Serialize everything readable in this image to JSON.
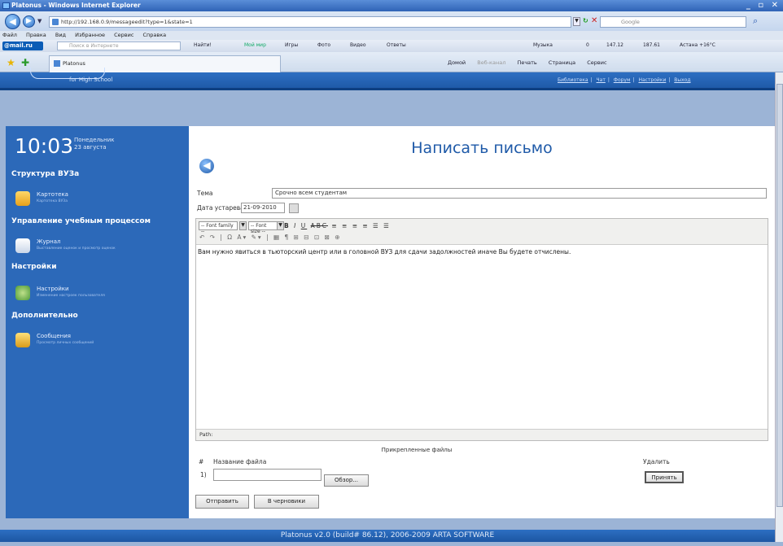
{
  "window": {
    "title": "Platonus - Windows Internet Explorer",
    "controls": "_ ▫ ✕"
  },
  "address": {
    "url": "http://192.168.0.9/messageedit?type=1&state=1",
    "search_placeholder": "Google"
  },
  "menu": [
    "Файл",
    "Правка",
    "Вид",
    "Избранное",
    "Сервис",
    "Справка"
  ],
  "toolbar2": {
    "logo": "@mail.ru",
    "search_placeholder": "Поиск в Интернете",
    "find": "Найти!",
    "items": [
      "Мой мир",
      "Игры",
      "Фото",
      "Видео",
      "Ответы",
      "Музыка",
      "0",
      "147.12",
      "187.61",
      "Астана +16°С"
    ]
  },
  "tab": {
    "label": "Platonus"
  },
  "cmdbar": [
    "Домой",
    "Веб-канал",
    "Печать",
    "Страница",
    "Сервис"
  ],
  "site": {
    "logo_text": "for High School",
    "top_links": [
      "Библиотека",
      "Чат",
      "Форум",
      "Настройки",
      "Выход"
    ]
  },
  "sidebar": {
    "time": "10:03",
    "weekday": "Понедельник",
    "date": "23 августа",
    "sections": [
      {
        "title": "Структура ВУЗа",
        "items": [
          {
            "title": "Картотека",
            "sub": "Картотека ВУЗа",
            "icon": "folder-icon"
          }
        ]
      },
      {
        "title": "Управление учебным процессом",
        "items": [
          {
            "title": "Журнал",
            "sub": "Выставление оценок и просмотр оценок",
            "icon": "book-icon"
          }
        ]
      },
      {
        "title": "Настройки",
        "items": [
          {
            "title": "Настройки",
            "sub": "Изменение настроек пользователя",
            "icon": "gear-icon"
          }
        ]
      },
      {
        "title": "Дополнительно",
        "items": [
          {
            "title": "Сообщения",
            "sub": "Просмотр личных сообщений",
            "icon": "message-icon"
          }
        ]
      }
    ]
  },
  "page": {
    "heading": "Написать письмо",
    "subject_label": "Тема",
    "subject_value": "Срочно всем студентам",
    "expiry_label": "Дата устаревания",
    "expiry_value": "21-09-2010",
    "font_family": "-- Font family --",
    "font_size": "-- Font size --",
    "body_text": "Вам нужно явиться в тьюторский центр или в головной ВУЗ для сдачи задолжностей иначе Вы будете отчислены.",
    "path_label": "Path:",
    "attach_title": "Прикрепленные файлы",
    "col_num": "#",
    "col_filename": "Название файла",
    "col_delete": "Удалить",
    "row_num": "1)",
    "browse": "Обзор...",
    "apply": "Принять",
    "send": "Отправить",
    "draft": "В черновики"
  },
  "footer": "Platonus v2.0 (build# 86.12), 2006-2009 ARTA SOFTWARE"
}
